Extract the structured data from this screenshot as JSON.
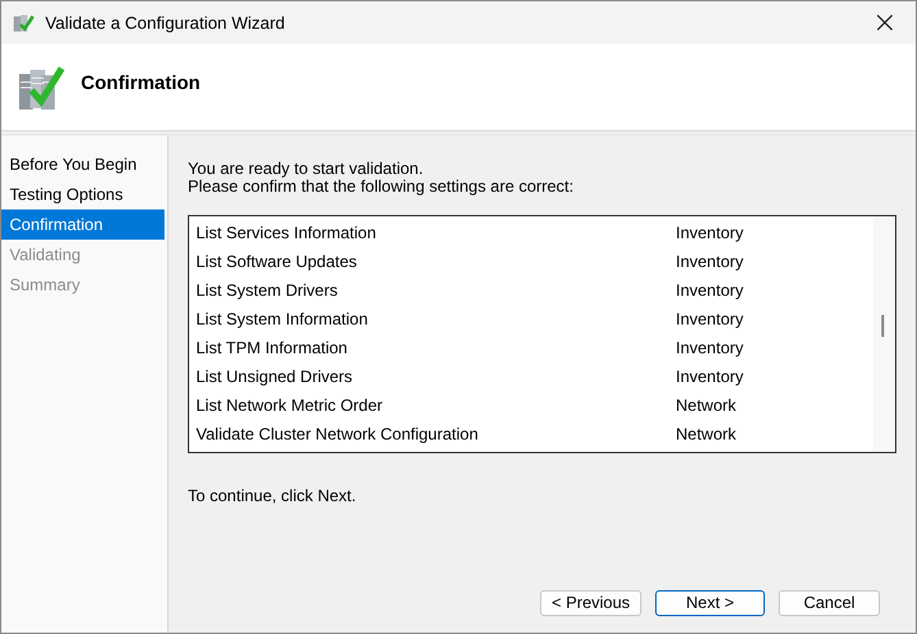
{
  "window": {
    "title": "Validate a Configuration Wizard"
  },
  "header": {
    "title": "Confirmation"
  },
  "steps": [
    {
      "label": "Before You Begin",
      "selected": false,
      "disabled": false
    },
    {
      "label": "Testing Options",
      "selected": false,
      "disabled": false
    },
    {
      "label": "Confirmation",
      "selected": true,
      "disabled": false
    },
    {
      "label": "Validating",
      "selected": false,
      "disabled": true
    },
    {
      "label": "Summary",
      "selected": false,
      "disabled": true
    }
  ],
  "intro": [
    "You are ready to start validation.",
    "Please confirm that the following settings are correct:"
  ],
  "tests": [
    {
      "name": "List Services Information",
      "category": "Inventory"
    },
    {
      "name": "List Software Updates",
      "category": "Inventory"
    },
    {
      "name": "List System Drivers",
      "category": "Inventory"
    },
    {
      "name": "List System Information",
      "category": "Inventory"
    },
    {
      "name": "List TPM Information",
      "category": "Inventory"
    },
    {
      "name": "List Unsigned Drivers",
      "category": "Inventory"
    },
    {
      "name": "List Network Metric Order",
      "category": "Network"
    },
    {
      "name": "Validate Cluster Network Configuration",
      "category": "Network"
    }
  ],
  "footer_note": "To continue, click Next.",
  "buttons": [
    {
      "label": "< Previous",
      "default": false
    },
    {
      "label": "Next >",
      "default": true
    },
    {
      "label": "Cancel",
      "default": false
    }
  ]
}
